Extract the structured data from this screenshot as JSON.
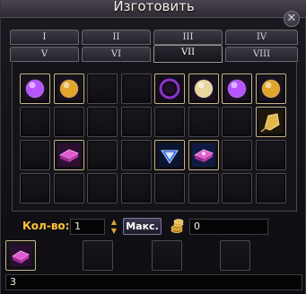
{
  "window": {
    "title": "Изготовить"
  },
  "tabs": [
    {
      "label": "I"
    },
    {
      "label": "II"
    },
    {
      "label": "III"
    },
    {
      "label": "IV"
    },
    {
      "label": "V"
    },
    {
      "label": "VI"
    },
    {
      "label": "VII"
    },
    {
      "label": "VIII"
    }
  ],
  "active_tab": "VII",
  "grid": {
    "rows": 4,
    "cols": 8,
    "items": [
      {
        "row": 0,
        "col": 0,
        "icon": "purple-orb-icon",
        "color": "#b455ff"
      },
      {
        "row": 0,
        "col": 1,
        "icon": "gold-orb-icon",
        "color": "#e0a52a"
      },
      {
        "row": 0,
        "col": 4,
        "icon": "dark-purple-orb-icon",
        "color": "#8a34c8"
      },
      {
        "row": 0,
        "col": 5,
        "icon": "pearl-icon",
        "color": "#e8d7a0"
      },
      {
        "row": 0,
        "col": 6,
        "icon": "purple-orb-icon",
        "color": "#b455ff"
      },
      {
        "row": 0,
        "col": 7,
        "icon": "gold-orb-icon",
        "color": "#e0a52a"
      },
      {
        "row": 1,
        "col": 7,
        "icon": "gold-crystal-icon",
        "color": "#e2b84a"
      },
      {
        "row": 2,
        "col": 1,
        "icon": "pink-book-icon",
        "color": "#e05ad0"
      },
      {
        "row": 2,
        "col": 4,
        "icon": "blue-crystal-icon",
        "color": "#3a6ee0"
      },
      {
        "row": 2,
        "col": 5,
        "icon": "pink-book-star-icon",
        "color": "#e05ad0"
      }
    ]
  },
  "quantity": {
    "label": "Кол-во:",
    "value": "1"
  },
  "max_button": {
    "label": "Макс."
  },
  "cost": {
    "value": "0"
  },
  "result": {
    "icon": "pink-book-icon",
    "count": "3"
  }
}
